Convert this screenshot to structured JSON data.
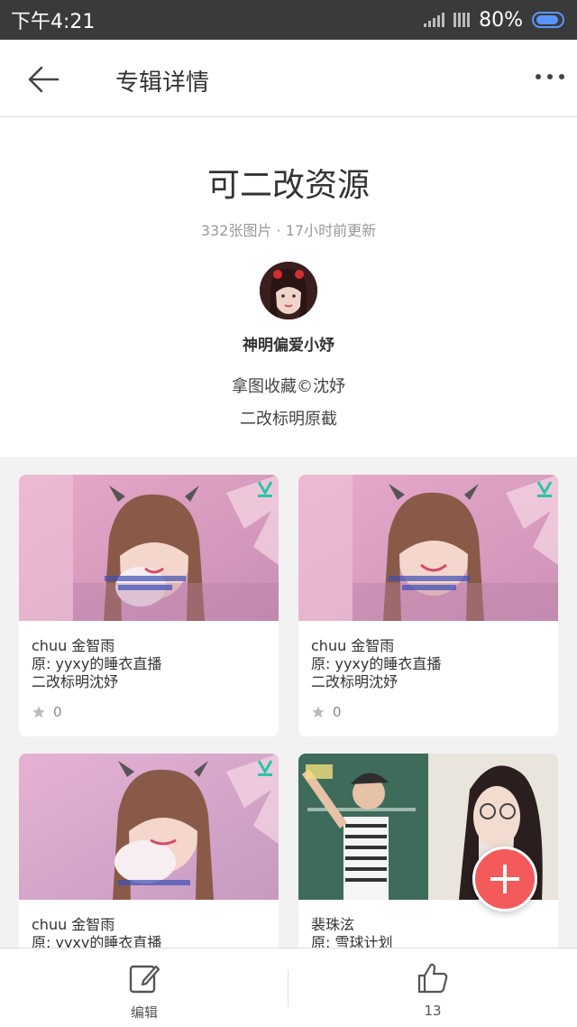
{
  "statusbar": {
    "time": "下午4:21",
    "battery": "80%"
  },
  "appbar": {
    "title": "专辑详情"
  },
  "album": {
    "name": "可二改资源",
    "meta": "332张图片 · 17小时前更新",
    "owner": "神明偏爱小妤",
    "desc_line1": "拿图收藏©沈妤",
    "desc_line2": "二改标明原截"
  },
  "cards": [
    {
      "line1": "chuu 金智雨",
      "line2": "原: yyxy的睡衣直播",
      "line3": "二改标明沈妤",
      "likes": "0"
    },
    {
      "line1": "chuu 金智雨",
      "line2": "原: yyxy的睡衣直播",
      "line3": "二改标明沈妤",
      "likes": "0"
    },
    {
      "line1": "chuu 金智雨",
      "line2": "原: yyxy的睡衣直播"
    },
    {
      "line1": "裴珠泫",
      "line2": "原: 雪球计划"
    }
  ],
  "bottombar": {
    "edit_label": "编辑",
    "like_count": "13"
  },
  "colors": {
    "accent": "#f35b5b",
    "statusbar": "#3a3a3a"
  }
}
